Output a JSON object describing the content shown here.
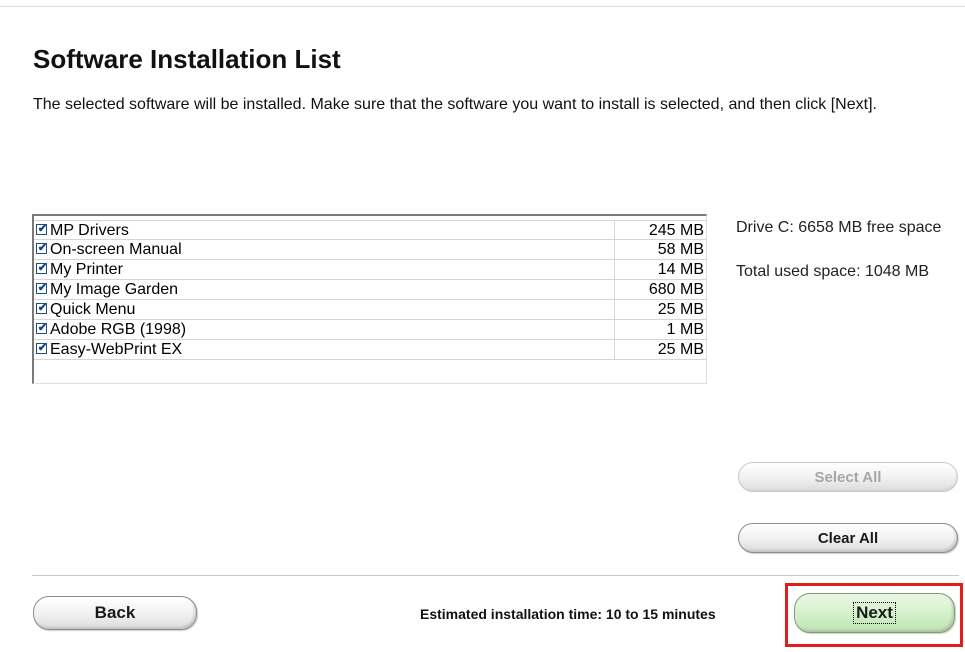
{
  "title": "Software Installation List",
  "description": "The selected software will be installed. Make sure that the software you want to install is selected, and then click [Next].",
  "software_list": [
    {
      "name": "MP Drivers",
      "size": "245 MB",
      "checked": true
    },
    {
      "name": "On-screen Manual",
      "size": "58 MB",
      "checked": true
    },
    {
      "name": "My Printer",
      "size": "14 MB",
      "checked": true
    },
    {
      "name": "My Image Garden",
      "size": "680 MB",
      "checked": true
    },
    {
      "name": "Quick Menu",
      "size": "25 MB",
      "checked": true
    },
    {
      "name": "Adobe RGB (1998)",
      "size": "1 MB",
      "checked": true
    },
    {
      "name": "Easy-WebPrint EX",
      "size": "25 MB",
      "checked": true
    }
  ],
  "drive_info": "Drive C: 6658 MB free space",
  "total_used": "Total used space: 1048 MB",
  "buttons": {
    "select_all": "Select All",
    "clear_all": "Clear All",
    "back": "Back",
    "next": "Next"
  },
  "estimate": "Estimated installation time: 10 to 15 minutes",
  "colors": {
    "highlight": "#e21b1b",
    "next_button": "#d3f0c9",
    "checkbox": "#0b3f8e"
  },
  "icons": {
    "checkbox": "check-icon"
  }
}
